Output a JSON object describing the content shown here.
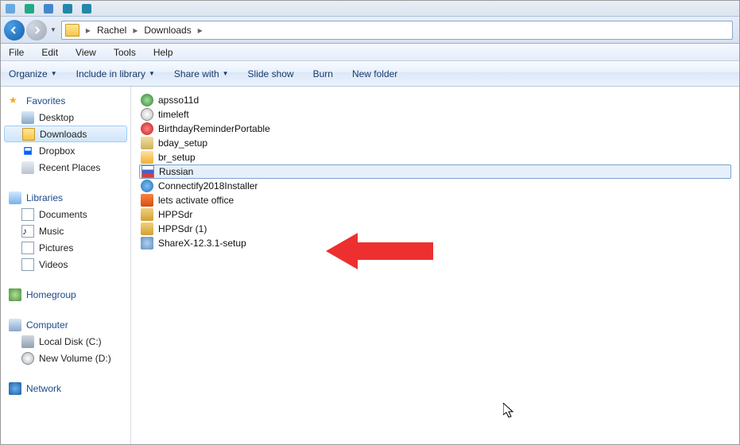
{
  "window": {
    "tabs": [
      {
        "label": ""
      },
      {
        "label": ""
      },
      {
        "label": ""
      },
      {
        "label": ""
      },
      {
        "label": ""
      }
    ]
  },
  "breadcrumb": {
    "segments": [
      "Rachel",
      "Downloads"
    ]
  },
  "menubar": {
    "file": "File",
    "edit": "Edit",
    "view": "View",
    "tools": "Tools",
    "help": "Help"
  },
  "commandbar": {
    "organize": "Organize",
    "include": "Include in library",
    "share": "Share with",
    "slideshow": "Slide show",
    "burn": "Burn",
    "newfolder": "New folder"
  },
  "sidebar": {
    "favorites": {
      "header": "Favorites",
      "items": [
        "Desktop",
        "Downloads",
        "Dropbox",
        "Recent Places"
      ],
      "selected_index": 1
    },
    "libraries": {
      "header": "Libraries",
      "items": [
        "Documents",
        "Music",
        "Pictures",
        "Videos"
      ]
    },
    "homegroup": {
      "header": "Homegroup"
    },
    "computer": {
      "header": "Computer",
      "items": [
        "Local Disk (C:)",
        "New Volume (D:)"
      ]
    },
    "network": {
      "header": "Network"
    }
  },
  "files": [
    {
      "name": "apsso11d",
      "icon": "globe"
    },
    {
      "name": "timeleft",
      "icon": "clock"
    },
    {
      "name": "BirthdayReminderPortable",
      "icon": "bday"
    },
    {
      "name": "bday_setup",
      "icon": "setup"
    },
    {
      "name": "br_setup",
      "icon": "br"
    },
    {
      "name": "Russian",
      "icon": "flag",
      "selected": true
    },
    {
      "name": "Connectify2018Installer",
      "icon": "conn"
    },
    {
      "name": "lets activate office",
      "icon": "office"
    },
    {
      "name": "HPPSdr",
      "icon": "hp"
    },
    {
      "name": "HPPSdr (1)",
      "icon": "hp"
    },
    {
      "name": "ShareX-12.3.1-setup",
      "icon": "sharex"
    }
  ],
  "annotation": {
    "arrow_target_index": 9
  }
}
